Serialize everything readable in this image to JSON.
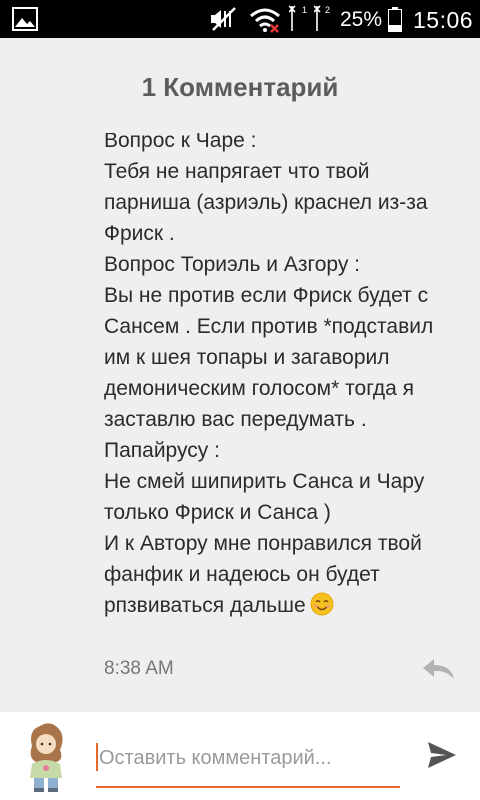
{
  "status_bar": {
    "sim1_label": "1",
    "sim2_label": "2",
    "battery_percent": "25%",
    "time": "15:06",
    "icons": [
      "gallery-icon",
      "mute-icon",
      "wifi-icon",
      "signal-sim1-icon",
      "signal-sim2-icon",
      "battery-icon"
    ]
  },
  "header": {
    "title": "1 Комментарий"
  },
  "comment": {
    "lines": [
      "Вопрос к Чаре :",
      "Тебя не напрягает что твой",
      "парниша (азриэль) краснел из-за",
      "Фриск .",
      "Вопрос Ториэль и Азгору :",
      "Вы не против если Фриск будет с",
      "Сансем . Если против *подставил",
      "им к шея топары и загаворил",
      "демоническим голосом* тогда я",
      "заставлю вас передумать .",
      "Папайрусу :",
      "Не смей шипирить Санса и Чару",
      "только Фриск и Санса )",
      "И к Автору мне понравился твой",
      "фанфик и надеюсь он будет",
      "рпзвиваться дальше"
    ],
    "emoji": "smiling-face-icon",
    "time": "8:38 AM"
  },
  "composer": {
    "placeholder": "Оставить комментарий...",
    "value": "",
    "accent_color": "#e8672a"
  }
}
